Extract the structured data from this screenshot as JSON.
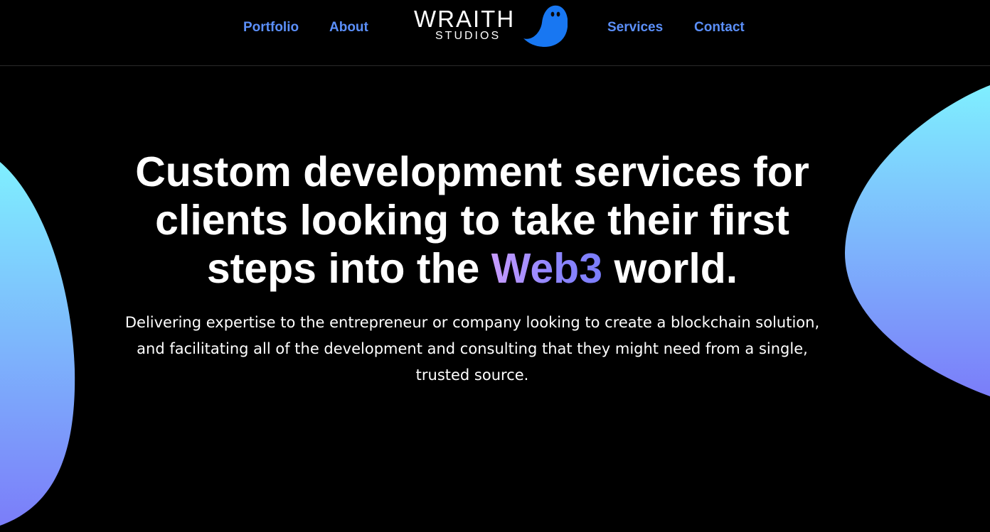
{
  "nav": {
    "portfolio": "Portfolio",
    "about": "About",
    "services": "Services",
    "contact": "Contact"
  },
  "logo": {
    "word": "WRAITH",
    "sub": "STUDIOS"
  },
  "hero": {
    "title_part1": "Custom development services for clients looking to take their first steps into the ",
    "title_accent": "Web3",
    "title_part2": " world.",
    "subtitle": "Delivering expertise to the entrepreneur or company looking to create a blockchain solution, and facilitating all of the development and consulting that they might need from a single, trusted source."
  },
  "colors": {
    "background": "#000000",
    "nav_link": "#5b8ff9",
    "ghost_blue": "#1877f2",
    "blob_top": "#7fefff",
    "blob_bottom": "#7b7df9",
    "accent_start": "#c79bff",
    "accent_end": "#7a7dfb"
  },
  "icons": {
    "logo_mark": "ghost-icon"
  }
}
